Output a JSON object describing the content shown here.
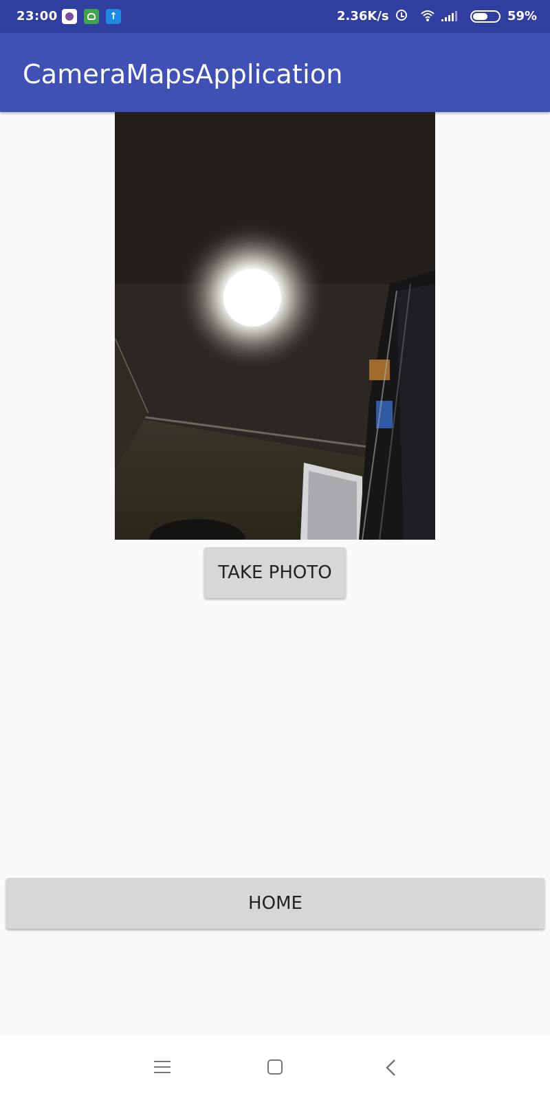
{
  "status_bar": {
    "time": "23:00",
    "network_speed": "2.36K/s",
    "battery_percent": "59%",
    "battery_level": 0.59,
    "notification_icons": [
      "viber-icon",
      "android-icon",
      "upload-icon"
    ],
    "system_icons": [
      "alarm-icon",
      "wifi-icon",
      "signal-icon",
      "battery-icon"
    ]
  },
  "app_bar": {
    "title": "CameraMapsApplication"
  },
  "main": {
    "photo_description_icon": "photo",
    "take_photo_label": "TAKE PHOTO",
    "home_label": "HOME"
  },
  "nav_bar": {
    "icons": [
      "menu-icon",
      "home-icon",
      "back-icon"
    ]
  },
  "colors": {
    "status_bar": "#303f9f",
    "app_bar": "#3f51b5",
    "background": "#fafafa",
    "button": "#d6d7d7"
  }
}
